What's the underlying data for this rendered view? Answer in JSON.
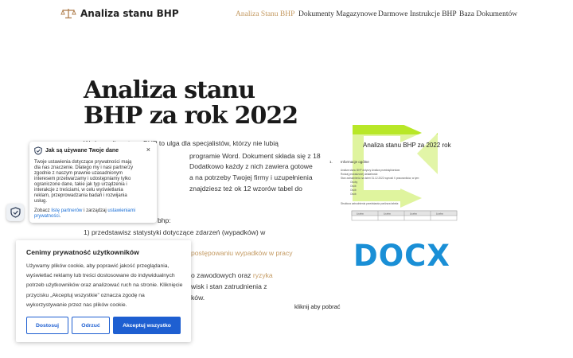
{
  "header": {
    "logo_text": "Analiza stanu BHP",
    "nav": [
      "Analiza Stanu BHP",
      "Dokumenty Magazynowe",
      "Darmowe Instrukcje BHP",
      "Baza Dokumentów"
    ]
  },
  "hero": {
    "title_line1": "Analiza stanu",
    "title_line2": "BHP za rok 2022",
    "paragraph_lines": [
      "Wzór analizy stanu BHP to ulga dla specjalistów, którzy nie lubią",
      "programie Word. Dokument składa się z 18",
      "Dodatkowo każdy z nich zawiera gotowe",
      "a na potrzeby Twojej firmy i uzupełnienia",
      "znajdziesz też ok 12 wzorów tabel do"
    ],
    "list_intro": "bhp:",
    "list_item_1": "1) przedstawisz statystyki dotyczące zdarzeń (wypadków) w",
    "list_item_2_link": "postępowaniu wypadków w pracy",
    "list_item_3_text": "o zawodowych oraz",
    "list_item_3_link": "ryzyka",
    "list_item_4": "wisk i stan zatrudnienia z",
    "list_item_5": "ków."
  },
  "document_preview": {
    "title": "Analiza stanu BHP za 2022 rok",
    "section_number": "1.",
    "section_title": "Informacje ogólne",
    "lines": [
      "Analiza stanu BHP dotyczy Analiza przedsiębiorstwa",
      "Rodzaj prowadzonej działalności:",
      "Stan zatrudnienia na dzień 31.12.2022 wynosił X pracowników, w tym:"
    ],
    "sub_items": [
      "Osoby",
      "Osób",
      "Osób",
      "Osób"
    ],
    "footer_line": "Struktura zatrudnienia przedstawia poniższa tabela:",
    "table_headers": [
      "Liczba",
      "Liczba",
      "Liczba",
      "Liczba"
    ]
  },
  "docx_label": "DOCX",
  "click_label": "kliknij aby pobrać",
  "privacy_popup": {
    "title": "Jak są używane Twoje dane",
    "body": "Twoje ustawienia dotyczące prywatności mają dla nas znaczenie. Dlatego my i nasi partnerzy zgodnie z naszym prawnie uzasadnionym interesem przetwarzamy i udostępniamy tylko ograniczone dane, takie jak typ urządzenia i interakcje z treściami, w celu wyświetlania reklam, przeprowadzania badań i rozwijania usług.",
    "footer_prefix": "Zobacz",
    "footer_link1": "listę partnerów",
    "footer_mid": "i zarządzaj",
    "footer_link2": "ustawieniami prywatności",
    "footer_suffix": ".",
    "close": "×"
  },
  "cookie_banner": {
    "title": "Cenimy prywatność użytkowników",
    "body": "Używamy plików cookie, aby poprawić jakość przeglądania, wyświetlać reklamy lub treści dostosowane do indywidualnych potrzeb użytkowników oraz analizować ruch na stronie. Kliknięcie przycisku „Akceptuj wszystkie” oznacza zgodę na wykorzystywanie przez nas plików cookie.",
    "btn_customize": "Dostosuj",
    "btn_reject": "Odrzuć",
    "btn_accept": "Akceptuj wszystko"
  },
  "colors": {
    "accent": "#c49a62",
    "docx": "#1a8fd6",
    "button": "#1e5fd1",
    "arrow": "#b5e61d"
  }
}
